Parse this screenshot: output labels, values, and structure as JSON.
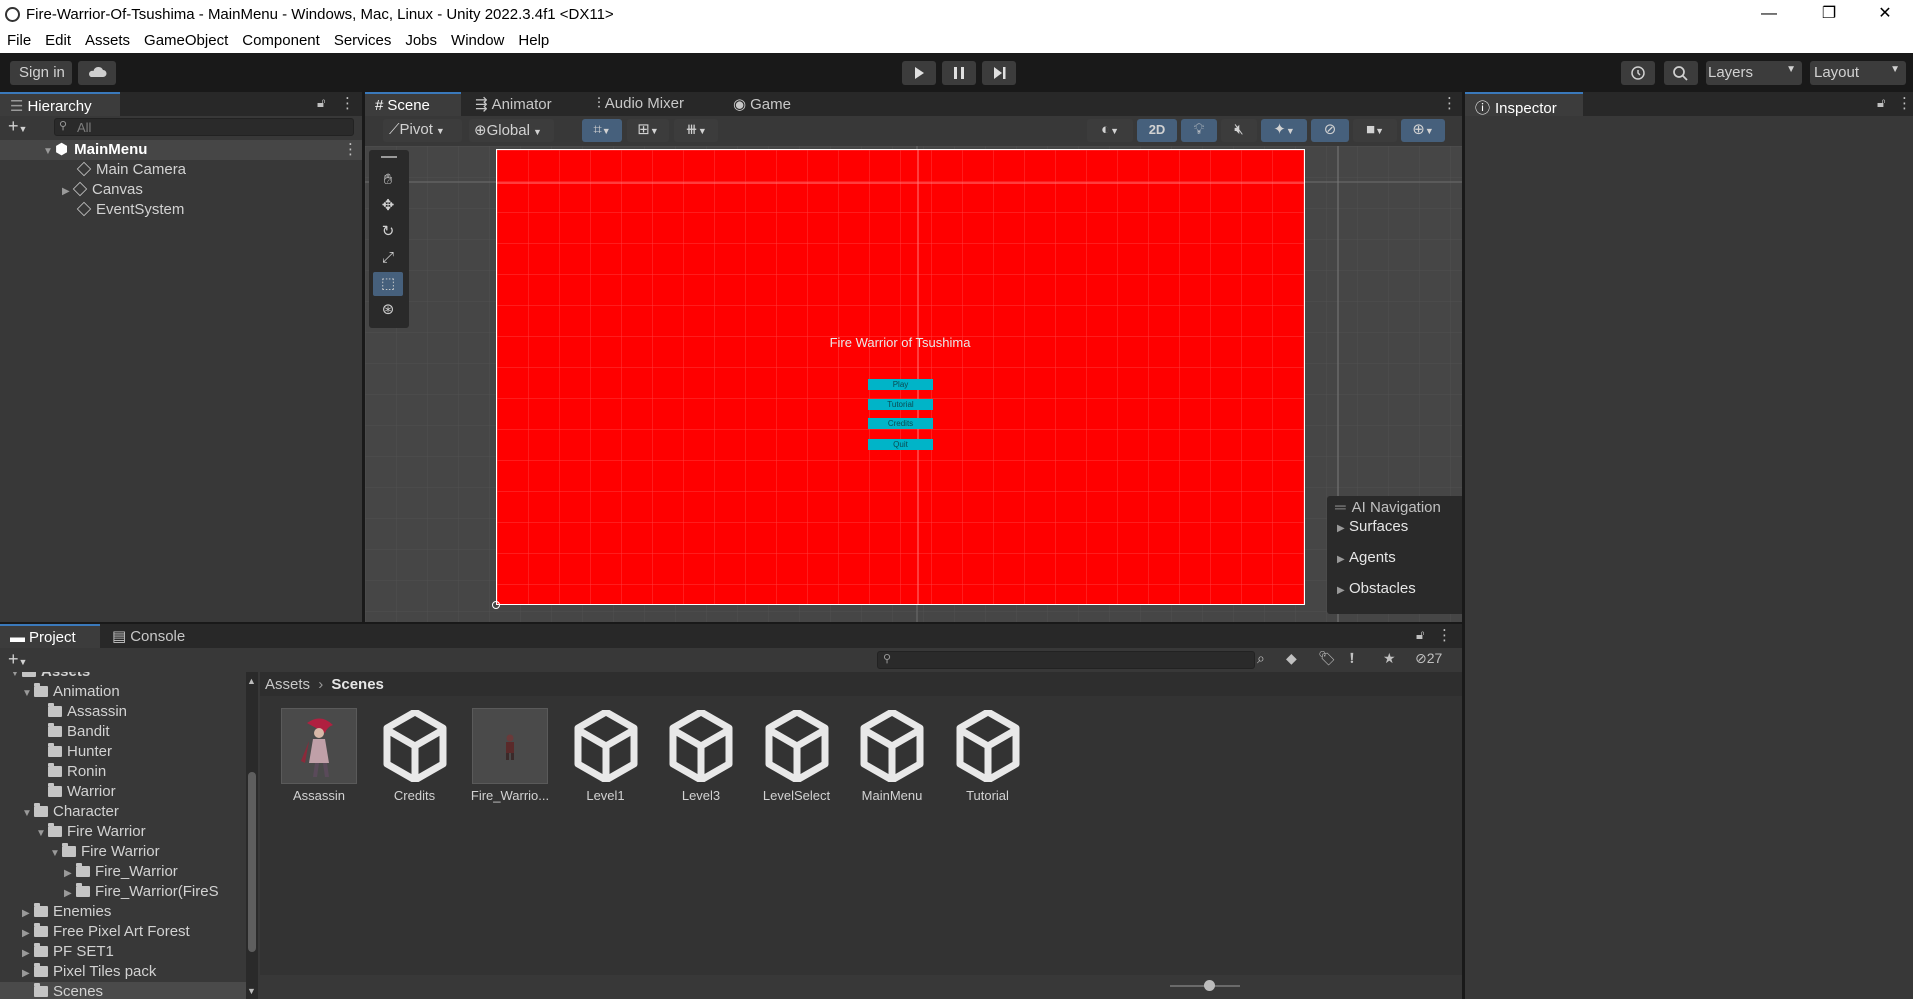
{
  "window": {
    "title": "Fire-Warrior-Of-Tsushima - MainMenu - Windows, Mac, Linux - Unity 2022.3.4f1 <DX11>",
    "minimize": "—",
    "restore": "❐",
    "close": "✕"
  },
  "menu": [
    "File",
    "Edit",
    "Assets",
    "GameObject",
    "Component",
    "Services",
    "Jobs",
    "Window",
    "Help"
  ],
  "toolbar": {
    "sign_in": "Sign in",
    "layers": "Layers",
    "layout": "Layout"
  },
  "hierarchy": {
    "tab": "Hierarchy",
    "search_placeholder": "All",
    "scene_name": "MainMenu",
    "items": [
      "Main Camera",
      "Canvas",
      "EventSystem"
    ]
  },
  "scene_tabs": [
    "Scene",
    "Animator",
    "Audio Mixer",
    "Game"
  ],
  "scene_toolbar": {
    "pivot": "Pivot",
    "global": "Global",
    "mode_2d": "2D"
  },
  "game_view": {
    "background": "#ff0000",
    "title": "Fire Warrior of Tsushima",
    "buttons": [
      "Play",
      "Tutorial",
      "Credits",
      "Quit"
    ],
    "button_color": "#00b4c8"
  },
  "ai_navigation": {
    "title": "AI Navigation",
    "items": [
      "Surfaces",
      "Agents",
      "Obstacles"
    ]
  },
  "inspector": {
    "tab": "Inspector"
  },
  "project": {
    "tabs": [
      "Project",
      "Console"
    ],
    "hidden_count": "27",
    "breadcrumb": [
      "Assets",
      "Scenes"
    ],
    "tree_top": "Assets",
    "tree": [
      {
        "label": "Animation",
        "depth": 1,
        "arrow": "open"
      },
      {
        "label": "Assassin",
        "depth": 2,
        "arrow": "none"
      },
      {
        "label": "Bandit",
        "depth": 2,
        "arrow": "none"
      },
      {
        "label": "Hunter",
        "depth": 2,
        "arrow": "none"
      },
      {
        "label": "Ronin",
        "depth": 2,
        "arrow": "none"
      },
      {
        "label": "Warrior",
        "depth": 2,
        "arrow": "none"
      },
      {
        "label": "Character",
        "depth": 1,
        "arrow": "open"
      },
      {
        "label": "Fire Warrior",
        "depth": 2,
        "arrow": "open"
      },
      {
        "label": "Fire Warrior",
        "depth": 3,
        "arrow": "open"
      },
      {
        "label": "Fire_Warrior",
        "depth": 4,
        "arrow": "closed"
      },
      {
        "label": "Fire_Warrior(FireS",
        "depth": 4,
        "arrow": "closed"
      },
      {
        "label": "Enemies",
        "depth": 1,
        "arrow": "closed"
      },
      {
        "label": "Free Pixel Art Forest",
        "depth": 1,
        "arrow": "closed"
      },
      {
        "label": "PF SET1",
        "depth": 1,
        "arrow": "closed"
      },
      {
        "label": "Pixel Tiles pack",
        "depth": 1,
        "arrow": "closed"
      },
      {
        "label": "Scenes",
        "depth": 1,
        "arrow": "none"
      }
    ],
    "assets": [
      {
        "label": "Assassin",
        "kind": "sprite"
      },
      {
        "label": "Credits",
        "kind": "scene"
      },
      {
        "label": "Fire_Warrio...",
        "kind": "sprite-small"
      },
      {
        "label": "Level1",
        "kind": "scene"
      },
      {
        "label": "Level3",
        "kind": "scene"
      },
      {
        "label": "LevelSelect",
        "kind": "scene"
      },
      {
        "label": "MainMenu",
        "kind": "scene"
      },
      {
        "label": "Tutorial",
        "kind": "scene"
      }
    ]
  }
}
